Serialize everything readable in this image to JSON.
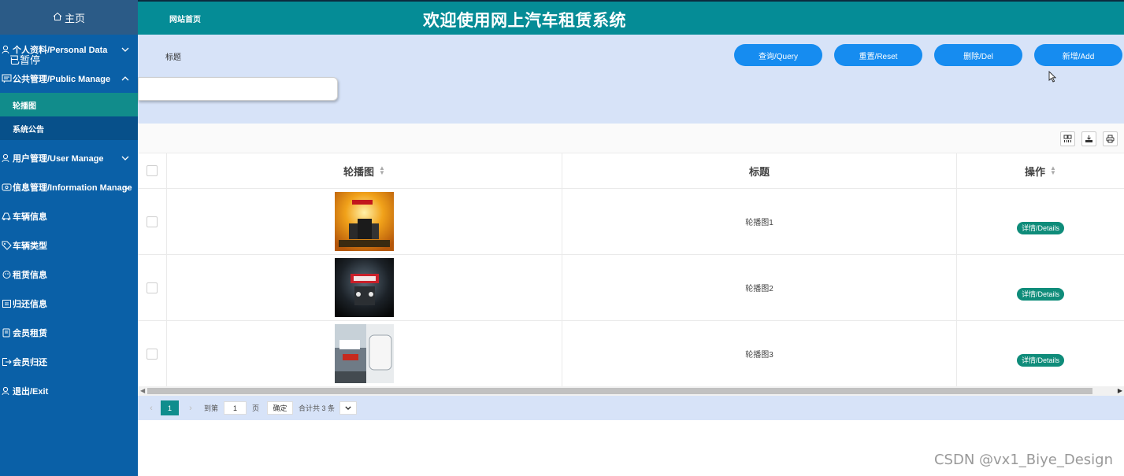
{
  "sidebar": {
    "home_label": "主页",
    "paused_overlay": "已暂停",
    "items": [
      {
        "label": "个人资料/Personal Data",
        "icon": "user-icon",
        "arrow": "chevron-down-icon"
      },
      {
        "label": "公共管理/Public Manage",
        "icon": "notice-icon",
        "arrow": "chevron-up-icon"
      },
      {
        "label": "用户管理/User Manage",
        "icon": "user-icon",
        "arrow": "chevron-down-icon"
      },
      {
        "label": "信息管理/Information Manage",
        "icon": "info-icon",
        "arrow": "chevron-down-icon"
      },
      {
        "label": "车辆信息",
        "icon": "car-icon"
      },
      {
        "label": "车辆类型",
        "icon": "tag-icon"
      },
      {
        "label": "租赁信息",
        "icon": "lease-icon"
      },
      {
        "label": "归还信息",
        "icon": "return-icon"
      },
      {
        "label": "会员租赁",
        "icon": "member-icon"
      },
      {
        "label": "会员归还",
        "icon": "exit-box-icon"
      },
      {
        "label": "退出/Exit",
        "icon": "user-icon"
      }
    ],
    "sub_items": [
      {
        "label": "轮播图",
        "active": true
      },
      {
        "label": "系统公告",
        "active": false
      }
    ]
  },
  "topbar": {
    "site_link": "网站首页",
    "title": "欢迎使用网上汽车租赁系统"
  },
  "search": {
    "field_label": "标题",
    "field_value": "",
    "buttons": {
      "query": "查询/Query",
      "reset": "重置/Reset",
      "delete": "删除/Del",
      "add": "新增/Add"
    }
  },
  "toolbar": {
    "icons": [
      "columns-icon",
      "export-icon",
      "print-icon"
    ]
  },
  "table": {
    "headers": {
      "image": "轮播图",
      "title": "标题",
      "ops": "操作"
    },
    "rows": [
      {
        "title": "轮播图1",
        "details": "详情/Details"
      },
      {
        "title": "轮播图2",
        "details": "详情/Details"
      },
      {
        "title": "轮播图3",
        "details": "详情/Details"
      }
    ]
  },
  "pager": {
    "current_page": "1",
    "goto_prefix": "到第",
    "goto_value": "1",
    "goto_suffix": "页",
    "confirm": "确定",
    "total": "合计共 3 条"
  },
  "watermark": "CSDN @vx1_Biye_Design",
  "colors": {
    "sidebar": "#0a60a7",
    "topbar": "#058c96",
    "panel": "#d7e3f8",
    "primary_button": "#168cf0",
    "active_menu": "#118c8b",
    "details_button": "#0f8c7a"
  }
}
